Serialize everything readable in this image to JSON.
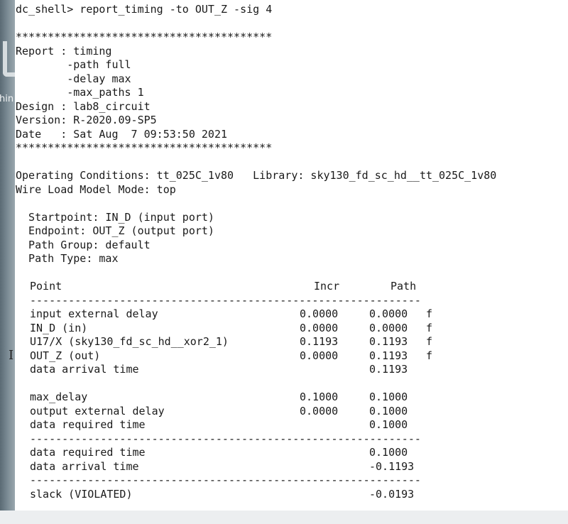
{
  "sidebar_text": "hin",
  "terminal": {
    "command": "dc_shell> report_timing -to OUT_Z -sig 4",
    "stars": "****************************************",
    "report_lines": [
      "Report : timing",
      "        -path full",
      "        -delay max",
      "        -max_paths 1",
      "Design : lab8_circuit",
      "Version: R-2020.09-SP5",
      "Date   : Sat Aug  7 09:53:50 2021"
    ],
    "operating_conditions": "Operating Conditions: tt_025C_1v80   Library: sky130_fd_sc_hd__tt_025C_1v80",
    "wire_load": "Wire Load Model Mode: top",
    "path_info": [
      "  Startpoint: IN_D (input port)",
      "  Endpoint: OUT_Z (output port)",
      "  Path Group: default",
      "  Path Type: max"
    ],
    "table_header": {
      "point": "Point",
      "incr": "Incr",
      "path": "Path"
    },
    "separator": "-------------------------------------------------------------",
    "arrival_rows": [
      {
        "point": "input external delay",
        "incr": "0.0000",
        "path": "0.0000",
        "flag": "f"
      },
      {
        "point": "IN_D (in)",
        "incr": "0.0000",
        "path": "0.0000",
        "flag": "f"
      },
      {
        "point": "U17/X (sky130_fd_sc_hd__xor2_1)",
        "incr": "0.1193",
        "path": "0.1193",
        "flag": "f"
      },
      {
        "point": "OUT_Z (out)",
        "incr": "0.0000",
        "path": "0.1193",
        "flag": "f"
      },
      {
        "point": "data arrival time",
        "incr": "",
        "path": "0.1193",
        "flag": ""
      }
    ],
    "required_rows": [
      {
        "point": "max_delay",
        "incr": "0.1000",
        "path": "0.1000",
        "flag": ""
      },
      {
        "point": "output external delay",
        "incr": "0.0000",
        "path": "0.1000",
        "flag": ""
      },
      {
        "point": "data required time",
        "incr": "",
        "path": "0.1000",
        "flag": ""
      }
    ],
    "summary_rows": [
      {
        "point": "data required time",
        "incr": "",
        "path": "0.1000",
        "flag": ""
      },
      {
        "point": "data arrival time",
        "incr": "",
        "path": "-0.1193",
        "flag": ""
      }
    ],
    "slack_row": {
      "point": "slack (VIOLATED)",
      "incr": "",
      "path": "-0.0193",
      "flag": ""
    }
  }
}
